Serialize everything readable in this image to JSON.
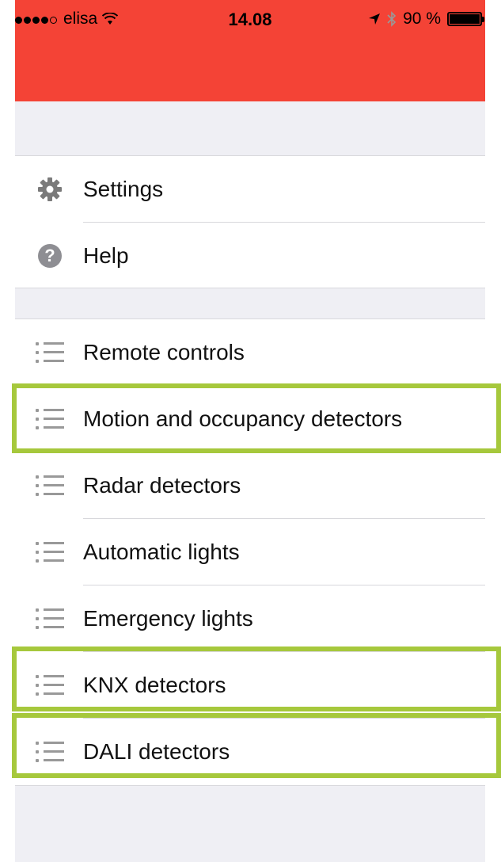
{
  "status_bar": {
    "carrier": "elisa",
    "time": "14.08",
    "battery_percent": "90 %"
  },
  "menu_top": [
    {
      "label": "Settings",
      "icon": "gear-icon"
    },
    {
      "label": "Help",
      "icon": "help-icon"
    }
  ],
  "menu_products": [
    {
      "label": "Remote controls",
      "icon": "list-icon"
    },
    {
      "label": "Motion and occupancy detectors",
      "icon": "list-icon"
    },
    {
      "label": "Radar detectors",
      "icon": "list-icon"
    },
    {
      "label": "Automatic lights",
      "icon": "list-icon"
    },
    {
      "label": "Emergency lights",
      "icon": "list-icon"
    },
    {
      "label": "KNX detectors",
      "icon": "list-icon"
    },
    {
      "label": "DALI detectors",
      "icon": "list-icon"
    }
  ],
  "colors": {
    "header": "#f44336",
    "highlight": "#a6c83c",
    "background": "#efeff4"
  }
}
